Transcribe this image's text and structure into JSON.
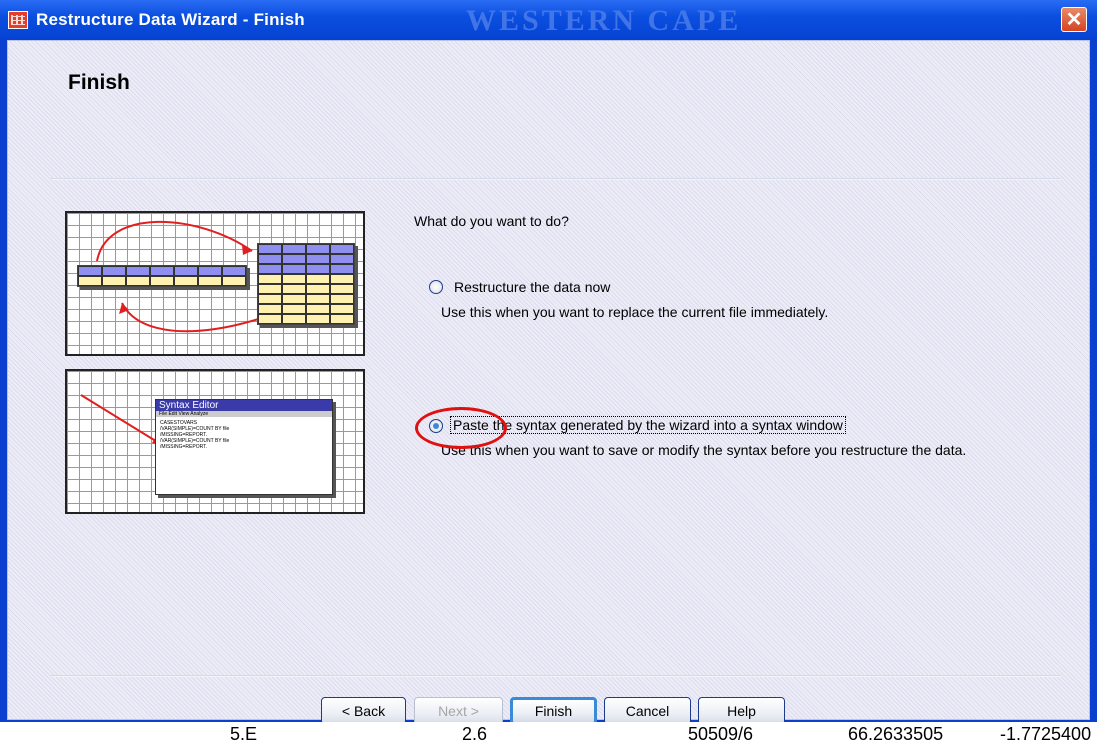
{
  "window": {
    "title": "Restructure Data Wizard - Finish",
    "watermark": "WESTERN CAPE",
    "close_glyph": "✕"
  },
  "page": {
    "title": "Finish",
    "question": "What do you want to do?"
  },
  "options": [
    {
      "label": "Restructure the data now",
      "mnemonic": "R",
      "description": "Use this when you want to replace the current file immediately.",
      "selected": false
    },
    {
      "label": "Paste the syntax generated by the wizard into a syntax window",
      "mnemonic": "P",
      "description": "Use this when you want to save or modify the syntax before you restructure the data.",
      "selected": true
    }
  ],
  "illustration": {
    "syntax_title": "Syntax Editor",
    "syntax_menu": "File Edit View Analyze",
    "syntax_lines": [
      "CASESTOVARS",
      "/VAR(SIMPLE)=COUNT BY file",
      "/MISSING=REPORT.",
      "/VAR(SIMPLE)=COUNT BY file",
      "/MISSING=REPORT."
    ]
  },
  "buttons": {
    "back": "< Back",
    "next": "Next >",
    "finish": "Finish",
    "cancel": "Cancel",
    "help": "Help"
  },
  "background_strip": [
    "5.E",
    "2.6",
    "50509/6",
    "66.2633505",
    "-1.7725400"
  ],
  "colors": {
    "titlebar": "#0b4fe0",
    "client_bg": "#eeedf7",
    "highlight_ring": "#e01010",
    "default_button_border": "#3a8ad8"
  }
}
